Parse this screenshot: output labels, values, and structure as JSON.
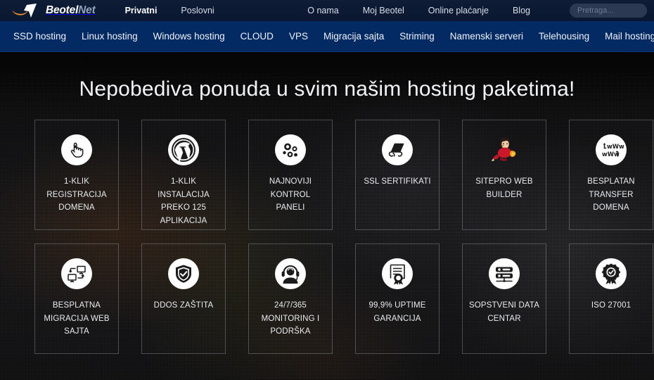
{
  "brand": {
    "logo_icon": "beotelnet-swoosh-logo",
    "name_primary": "Beotel",
    "name_secondary": "Net"
  },
  "colors": {
    "topbar_bg": "#0e1c36",
    "nav_bg": "#042a63",
    "accent_orange": "#e8902a",
    "text_light": "#eef2f8",
    "tile_border": "rgba(200,205,215,0.30)"
  },
  "topnav": {
    "left": [
      {
        "label": "Privatni",
        "active": true
      },
      {
        "label": "Poslovni",
        "active": false
      }
    ],
    "right": [
      {
        "label": "O nama"
      },
      {
        "label": "Moj Beotel"
      },
      {
        "label": "Online plaćanje"
      },
      {
        "label": "Blog"
      }
    ],
    "search": {
      "placeholder": "Pretraga...",
      "value": "",
      "icon": "search-icon"
    }
  },
  "mainnav": {
    "items": [
      {
        "label": "SSD hosting"
      },
      {
        "label": "Linux hosting"
      },
      {
        "label": "Windows hosting"
      },
      {
        "label": "CLOUD"
      },
      {
        "label": "VPS"
      },
      {
        "label": "Migracija sajta"
      },
      {
        "label": "Striming"
      },
      {
        "label": "Namenski serveri"
      },
      {
        "label": "Telehousing"
      },
      {
        "label": "Mail hosting"
      }
    ]
  },
  "hero": {
    "headline": "Nepobediva ponuda u svim našim hosting paketima!",
    "features": [
      {
        "icon": "one-click-pointer-hand-icon",
        "label": "1-KLIK\nREGISTRACIJA\nDOMENA"
      },
      {
        "icon": "wordpress-icon",
        "label": "1-KLIK INSTALACIJA\nPREKO 125\nAPLIKACIJA"
      },
      {
        "icon": "control-panel-gears-icon",
        "label": "NAJNOVIJI KONTROL\nPANELI"
      },
      {
        "icon": "ssl-certificate-scroll-icon",
        "label": "SSL SERTIFIKATI"
      },
      {
        "icon": "sitepro-mascot-icon",
        "label": "SITEPRO WEB\nBUILDER"
      },
      {
        "icon": "domain-transfer-www-icon",
        "label": "BESPLATAN\nTRANSFER DOMENA"
      },
      {
        "icon": "site-migration-monitors-icon",
        "label": "BESPLATNA\nMIGRACIJA WEB\nSAJTA"
      },
      {
        "icon": "shield-check-icon",
        "label": "DDOS ZAŠTITA"
      },
      {
        "icon": "support-headset-icon",
        "label": "24/7/365\nMONITORING I\nPODRŠKA"
      },
      {
        "icon": "uptime-certificate-icon",
        "label": "99,9% UPTIME\nGARANCIJA"
      },
      {
        "icon": "data-center-server-icon",
        "label": "SOPSTVENI DATA\nCENTAR"
      },
      {
        "icon": "iso-award-badge-icon",
        "label": "ISO 27001"
      }
    ]
  }
}
